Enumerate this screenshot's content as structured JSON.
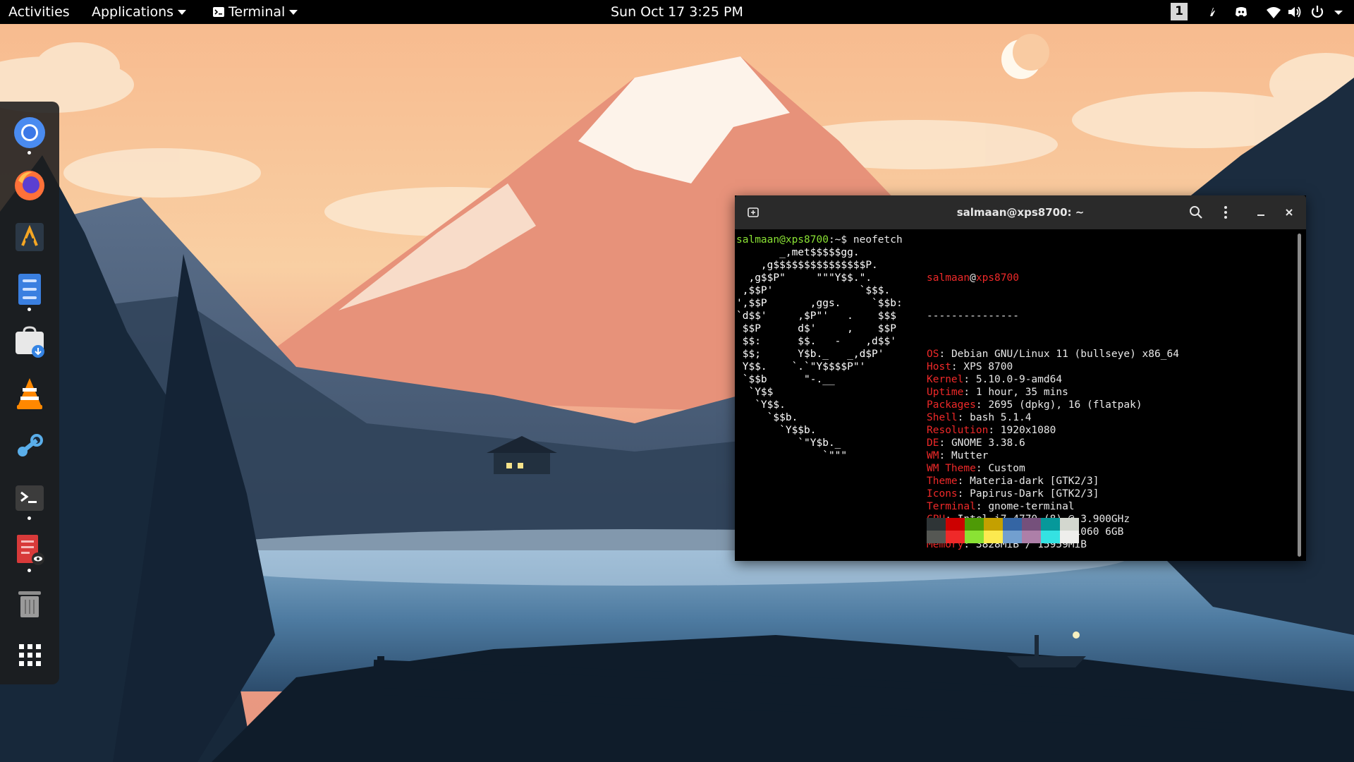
{
  "topbar": {
    "activities": "Activities",
    "applications": "Applications",
    "app_menu": "Terminal",
    "clock": "Sun Oct 17  3:25 PM",
    "workspace": "1",
    "tray_icons": [
      "extension-icon",
      "discord-icon",
      "wifi-icon",
      "volume-icon",
      "power-icon",
      "chevron-down-icon"
    ]
  },
  "dock": {
    "apps": [
      {
        "name": "Chromium",
        "icon": "chromium-icon",
        "running": true
      },
      {
        "name": "Firefox",
        "icon": "firefox-icon",
        "running": false
      },
      {
        "name": "Anaconda Navigator",
        "icon": "anaconda-icon",
        "running": false
      },
      {
        "name": "Files",
        "icon": "files-icon",
        "running": true
      },
      {
        "name": "Software",
        "icon": "software-icon",
        "running": false
      },
      {
        "name": "VLC",
        "icon": "vlc-icon",
        "running": false
      },
      {
        "name": "Steam",
        "icon": "steam-icon",
        "running": false
      },
      {
        "name": "Terminal",
        "icon": "terminal-icon",
        "running": true
      },
      {
        "name": "Document Viewer",
        "icon": "document-viewer-icon",
        "running": true
      },
      {
        "name": "Trash",
        "icon": "trash-icon",
        "running": false
      },
      {
        "name": "Show Applications",
        "icon": "app-grid-icon",
        "running": false
      }
    ]
  },
  "terminal": {
    "title": "salmaan@xps8700: ~",
    "prompt_user": "salmaan@xps8700",
    "prompt_suffix": ":~$ ",
    "command": "neofetch",
    "logo_lines": [
      "       _,met$$$$$gg.",
      "    ,g$$$$$$$$$$$$$$$P.",
      "  ,g$$P\"     \"\"\"Y$$.\".",
      " ,$$P'              `$$$.",
      "',$$P       ,ggs.     `$$b:",
      "`d$$'     ,$P\"'   .    $$$",
      " $$P      d$'     ,    $$P",
      " $$:      $$.   -    ,d$$'",
      " $$;      Y$b._   _,d$P'",
      " Y$$.    `.`\"Y$$$$P\"'",
      " `$$b      \"-.__",
      "  `Y$$",
      "   `Y$$.",
      "     `$$b.",
      "       `Y$$b.",
      "          `\"Y$b._",
      "              `\"\"\""
    ],
    "host_user": "salmaan",
    "host_at": "@",
    "host_name": "xps8700",
    "separator": "---------------",
    "info": [
      {
        "key": "OS",
        "value": "Debian GNU/Linux 11 (bullseye) x86_64"
      },
      {
        "key": "Host",
        "value": "XPS 8700"
      },
      {
        "key": "Kernel",
        "value": "5.10.0-9-amd64"
      },
      {
        "key": "Uptime",
        "value": "1 hour, 35 mins"
      },
      {
        "key": "Packages",
        "value": "2695 (dpkg), 16 (flatpak)"
      },
      {
        "key": "Shell",
        "value": "bash 5.1.4"
      },
      {
        "key": "Resolution",
        "value": "1920x1080"
      },
      {
        "key": "DE",
        "value": "GNOME 3.38.6"
      },
      {
        "key": "WM",
        "value": "Mutter"
      },
      {
        "key": "WM Theme",
        "value": "Custom"
      },
      {
        "key": "Theme",
        "value": "Materia-dark [GTK2/3]"
      },
      {
        "key": "Icons",
        "value": "Papirus-Dark [GTK2/3]"
      },
      {
        "key": "Terminal",
        "value": "gnome-terminal"
      },
      {
        "key": "CPU",
        "value": "Intel i7-4770 (8) @ 3.900GHz"
      },
      {
        "key": "GPU",
        "value": "NVIDIA GeForce GTX 1060 6GB"
      },
      {
        "key": "Memory",
        "value": "3828MiB / 15959MiB"
      }
    ],
    "palette": [
      "#2e3436",
      "#cc0000",
      "#4e9a06",
      "#c4a000",
      "#3465a4",
      "#75507b",
      "#06989a",
      "#d3d7cf",
      "#555753",
      "#ef2929",
      "#8ae234",
      "#fce94f",
      "#729fcf",
      "#ad7fa8",
      "#34e2e2",
      "#eeeeec"
    ]
  }
}
